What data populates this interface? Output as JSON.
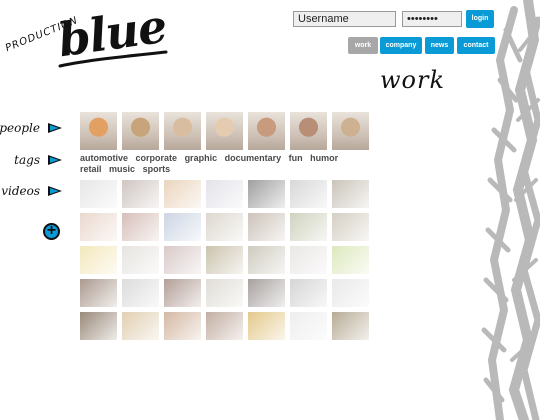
{
  "logo": {
    "small_text": "PRODUCTION",
    "large_text": "blue"
  },
  "login": {
    "username_value": "Username",
    "password_value": "••••••••",
    "button_label": "login"
  },
  "nav": {
    "items": [
      {
        "label": "work",
        "state": "active"
      },
      {
        "label": "company",
        "state": "default"
      },
      {
        "label": "news",
        "state": "default"
      },
      {
        "label": "contact",
        "state": "default"
      }
    ]
  },
  "page_title": "work",
  "sidebar": {
    "items": [
      {
        "label": "people",
        "icon": "arrow-right-icon"
      },
      {
        "label": "tags",
        "icon": "arrow-right-icon"
      },
      {
        "label": "videos",
        "icon": "arrow-right-icon"
      }
    ],
    "plus_symbol": "+"
  },
  "tags": [
    "automotive",
    "corporate",
    "graphic",
    "documentary",
    "fun",
    "humor",
    "retail",
    "music",
    "sports"
  ],
  "colors": {
    "accent": "#0a9bd6",
    "nav_inactive": "#a7a7a7",
    "tag_text": "#4a4a4a"
  },
  "people_thumbnails": [
    {
      "icon": "person-thumbnail",
      "tone": "#e2a062"
    },
    {
      "icon": "person-thumbnail",
      "tone": "#c7a47a"
    },
    {
      "icon": "person-thumbnail",
      "tone": "#d9bda0"
    },
    {
      "icon": "person-thumbnail",
      "tone": "#e5cbb0"
    },
    {
      "icon": "person-thumbnail",
      "tone": "#c89a7e"
    },
    {
      "icon": "person-thumbnail",
      "tone": "#b88f76"
    },
    {
      "icon": "person-thumbnail",
      "tone": "#ceb190"
    }
  ],
  "video_thumbnails": [
    [
      "#e7e7e7",
      "#cfc6c2",
      "#ead5bd",
      "#e3e3ea",
      "#9f9f9f",
      "#d8d8d8",
      "#cac4ba"
    ],
    [
      "#ead8cf",
      "#d6bfb9",
      "#cdd6e4",
      "#ddd8cf",
      "#cdc3ba",
      "#cfd2bf",
      "#d5cfc3"
    ],
    [
      "#f3e8bc",
      "#e7e4e0",
      "#d9cac9",
      "#cbc3ad",
      "#cecbbf",
      "#eae7e6",
      "#dde9bf"
    ],
    [
      "#ab9a8f",
      "#dcdcdc",
      "#b39f98",
      "#e0ddd6",
      "#a7a19e",
      "#d5d5d5",
      "#e9e9e9"
    ],
    [
      "#9a8a7a",
      "#e1cfb2",
      "#d4b8a3",
      "#c3aea2",
      "#e3c98a",
      "#eeeeee",
      "#b7ab95"
    ]
  ]
}
